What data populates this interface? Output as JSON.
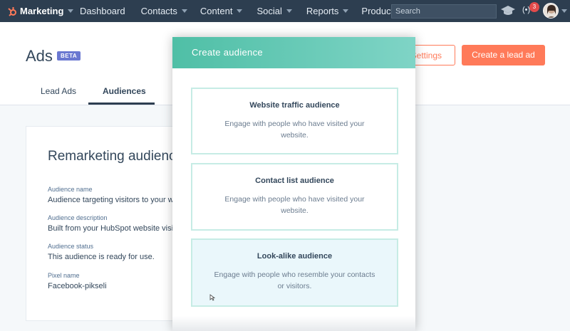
{
  "nav": {
    "brand": "Marketing",
    "items": [
      "Dashboard",
      "Contacts",
      "Content",
      "Social",
      "Reports",
      "Productivity"
    ],
    "search_placeholder": "Search",
    "notification_count": "3",
    "notification_glyph": "(•)",
    "accent_color": "#ff7a59",
    "bar_color": "#2d3e50"
  },
  "header": {
    "title": "Ads",
    "badge": "BETA",
    "settings_label": "Settings",
    "create_label": "Create a lead ad",
    "tabs": [
      "Lead Ads",
      "Audiences"
    ],
    "active_tab": "Audiences"
  },
  "card": {
    "title": "Remarketing audience",
    "fields": [
      {
        "label": "Audience name",
        "value": "Audience targeting visitors to your w"
      },
      {
        "label": "Audience description",
        "value": "Built from your HubSpot website visit"
      },
      {
        "label": "Audience status",
        "value": "This audience is ready for use."
      },
      {
        "label": "Pixel name",
        "value": "Facebook-pikseli"
      }
    ]
  },
  "modal": {
    "title": "Create audience",
    "options": [
      {
        "title": "Website traffic audience",
        "desc": "Engage with people who have visited your website."
      },
      {
        "title": "Contact list audience",
        "desc": "Engage with people who have visited your website."
      },
      {
        "title": "Look-alike audience",
        "desc": "Engage with people who resemble your contacts or visitors."
      }
    ],
    "selected_option": "Look-alike audience"
  }
}
